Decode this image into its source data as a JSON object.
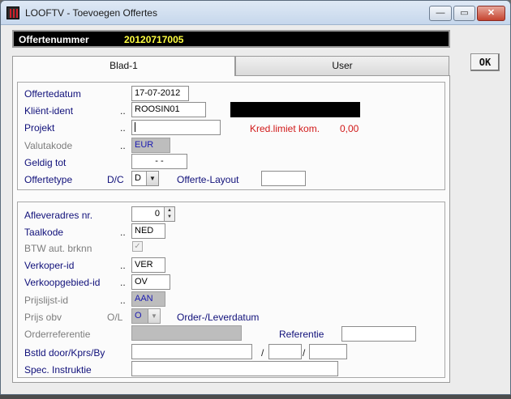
{
  "window": {
    "title": "LOOFTV - Toevoegen Offertes",
    "minimize": "—",
    "maximize": "▭",
    "close": "✕"
  },
  "header": {
    "label": "Offertenummer",
    "value": "20120717005"
  },
  "ok_label": "OK",
  "tabs": [
    {
      "label": "Blad-1",
      "active": true
    },
    {
      "label": "User",
      "active": false
    }
  ],
  "general": {
    "offertedatum": {
      "label": "Offertedatum",
      "value": "17-07-2012"
    },
    "klient": {
      "label": "Kliënt-ident",
      "dots": "..",
      "value": "ROOSIN01",
      "name": ""
    },
    "projekt": {
      "label": "Projekt",
      "dots": "..",
      "value": ""
    },
    "credit": {
      "label": "Kred.limiet kom.",
      "value": "0,00"
    },
    "valutakode": {
      "label": "Valutakode",
      "dots": "..",
      "value": "EUR"
    },
    "geldig_tot": {
      "label": "Geldig tot",
      "value": "- -"
    },
    "offertetype": {
      "label": "Offertetype",
      "dc_label": "D/C",
      "value": "D"
    },
    "layout": {
      "label": "Offerte-Layout",
      "value": ""
    }
  },
  "details": {
    "afleveradres": {
      "label": "Afleveradres nr.",
      "value": "0"
    },
    "taalkode": {
      "label": "Taalkode",
      "dots": "..",
      "value": "NED"
    },
    "btw": {
      "label": "BTW aut. brknn",
      "checked": true,
      "check_glyph": "✓"
    },
    "verkoper": {
      "label": "Verkoper-id",
      "dots": "..",
      "value": "VER"
    },
    "verkoopgebied": {
      "label": "Verkoopgebied-id",
      "dots": "..",
      "value": "OV"
    },
    "prijslijst": {
      "label": "Prijslijst-id",
      "dots": "..",
      "value": "AAN"
    },
    "prijs_obv": {
      "label": "Prijs obv",
      "ol_label": "O/L",
      "value": "O",
      "desc": "Order-/Leverdatum"
    },
    "orderreferentie": {
      "label": "Orderreferentie",
      "value": ""
    },
    "referentie": {
      "label": "Referentie",
      "value": ""
    },
    "bstld": {
      "label": "Bstld door/Kprs/By",
      "sep1": "/",
      "sep2": "/",
      "v1": "",
      "v2": "",
      "v3": ""
    },
    "spec": {
      "label": "Spec. Instruktie",
      "value": ""
    }
  }
}
